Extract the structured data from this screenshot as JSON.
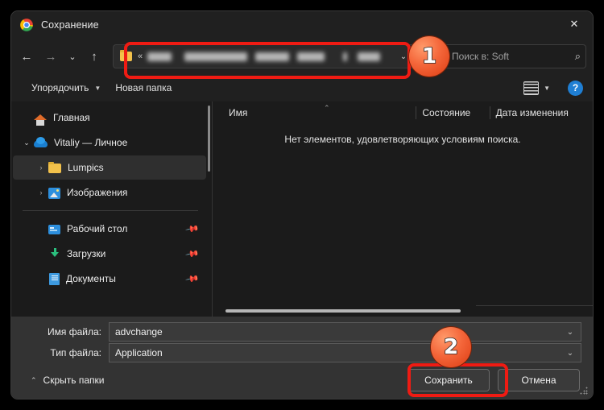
{
  "window": {
    "title": "Сохранение",
    "app_icon": "chrome-icon",
    "close_label": "✕"
  },
  "navbar": {
    "back_icon": "←",
    "forward_icon": "→",
    "recent_icon": "⌄",
    "up_icon": "↑",
    "address": {
      "folder_icon": "folder-icon",
      "overflow_chevron": "«",
      "path_text": "",
      "path_redacted": true,
      "dropdown_icon": "⌄"
    },
    "refresh_icon": "⟳",
    "search": {
      "placeholder": "Поиск в: Soft",
      "icon": "search-icon"
    }
  },
  "commandbar": {
    "organize_label": "Упорядочить",
    "organize_caret": "▼",
    "new_folder_label": "Новая папка",
    "view_icon": "list-view-icon",
    "view_caret": "▼",
    "help_label": "?"
  },
  "sidebar": {
    "items": [
      {
        "label": "Главная",
        "icon": "home-icon",
        "chevron": "",
        "selected": false,
        "pinned": false,
        "indent": 0
      },
      {
        "label": "Vitaliy — Личное",
        "icon": "onedrive-cloud-icon",
        "chevron": "⌄",
        "selected": false,
        "pinned": false,
        "indent": 0
      },
      {
        "label": "Lumpics",
        "icon": "folder-icon",
        "chevron": "›",
        "selected": true,
        "pinned": false,
        "indent": 1
      },
      {
        "label": "Изображения",
        "icon": "pictures-icon",
        "chevron": "›",
        "selected": false,
        "pinned": false,
        "indent": 1
      }
    ],
    "quick_access": [
      {
        "label": "Рабочий стол",
        "icon": "desktop-icon",
        "pinned": true
      },
      {
        "label": "Загрузки",
        "icon": "downloads-icon",
        "pinned": true
      },
      {
        "label": "Документы",
        "icon": "documents-icon",
        "pinned": true
      }
    ],
    "pin_icon": "📌"
  },
  "filepane": {
    "columns": [
      {
        "key": "name",
        "label": "Имя",
        "sort": "asc"
      },
      {
        "key": "state",
        "label": "Состояние",
        "sort": ""
      },
      {
        "key": "date",
        "label": "Дата изменения",
        "sort": ""
      }
    ],
    "sort_caret": "⌃",
    "rows": [],
    "empty_message": "Нет элементов, удовлетворяющих условиям поиска."
  },
  "footer": {
    "filename": {
      "label": "Имя файла:",
      "value": "advchange",
      "dropdown_icon": "⌄"
    },
    "filetype": {
      "label": "Тип файла:",
      "value": "Application",
      "dropdown_icon": "⌄"
    },
    "hide_folders_label": "Скрыть папки",
    "hide_folders_caret": "⌃",
    "save_label": "Сохранить",
    "cancel_label": "Отмена"
  },
  "annotations": {
    "step_one": "1",
    "step_two": "2",
    "highlight_color": "#ef1b13"
  }
}
